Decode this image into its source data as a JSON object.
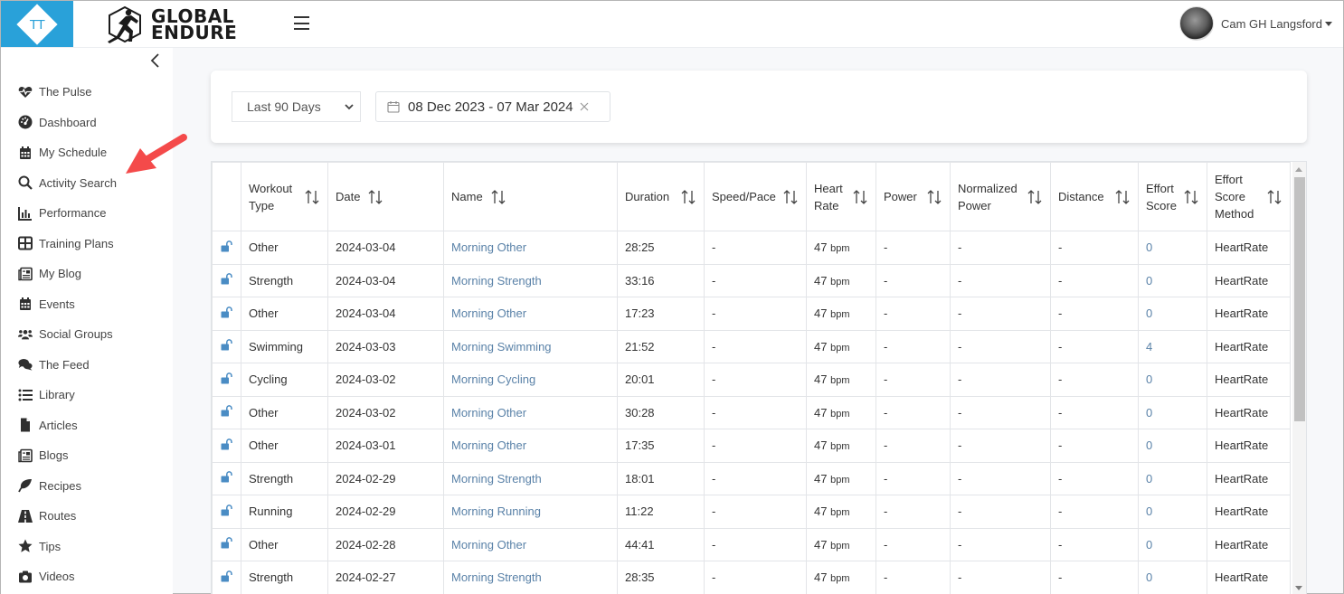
{
  "brand": {
    "tile_text": "TT",
    "logo_line1": "GLOBAL",
    "logo_line2": "ENDURE",
    "accent": "#29a1d9"
  },
  "user": {
    "name": "Cam GH Langsford"
  },
  "sidebar": {
    "items": [
      {
        "label": "The Pulse",
        "icon": "heartbeat-icon"
      },
      {
        "label": "Dashboard",
        "icon": "gauge-icon"
      },
      {
        "label": "My Schedule",
        "icon": "calendar-icon"
      },
      {
        "label": "Activity Search",
        "icon": "search-icon"
      },
      {
        "label": "Performance",
        "icon": "bar-chart-icon"
      },
      {
        "label": "Training Plans",
        "icon": "grid-icon"
      },
      {
        "label": "My Blog",
        "icon": "newspaper-icon"
      },
      {
        "label": "Events",
        "icon": "calendar-icon"
      },
      {
        "label": "Social Groups",
        "icon": "users-icon"
      },
      {
        "label": "The Feed",
        "icon": "comments-icon"
      },
      {
        "label": "Library",
        "icon": "list-icon"
      },
      {
        "label": "Articles",
        "icon": "file-icon"
      },
      {
        "label": "Blogs",
        "icon": "newspaper-icon"
      },
      {
        "label": "Recipes",
        "icon": "leaf-icon"
      },
      {
        "label": "Routes",
        "icon": "road-icon"
      },
      {
        "label": "Tips",
        "icon": "star-icon"
      },
      {
        "label": "Videos",
        "icon": "camera-icon"
      }
    ]
  },
  "filters": {
    "range_select": "Last 90 Days",
    "date_range": "08 Dec 2023 - 07 Mar 2024"
  },
  "table": {
    "columns": [
      "Workout Type",
      "Date",
      "Name",
      "Duration",
      "Speed/Pace",
      "Heart Rate",
      "Power",
      "Normalized Power",
      "Distance",
      "Effort Score",
      "Effort Score Method"
    ],
    "rows": [
      {
        "type": "Other",
        "date": "2024-03-04",
        "name": "Morning Other",
        "duration": "28:25",
        "speed": "-",
        "hr": "47",
        "hr_unit": "bpm",
        "power": "-",
        "np": "-",
        "distance": "-",
        "effort": "0",
        "method": "HeartRate"
      },
      {
        "type": "Strength",
        "date": "2024-03-04",
        "name": "Morning Strength",
        "duration": "33:16",
        "speed": "-",
        "hr": "47",
        "hr_unit": "bpm",
        "power": "-",
        "np": "-",
        "distance": "-",
        "effort": "0",
        "method": "HeartRate"
      },
      {
        "type": "Other",
        "date": "2024-03-04",
        "name": "Morning Other",
        "duration": "17:23",
        "speed": "-",
        "hr": "47",
        "hr_unit": "bpm",
        "power": "-",
        "np": "-",
        "distance": "-",
        "effort": "0",
        "method": "HeartRate"
      },
      {
        "type": "Swimming",
        "date": "2024-03-03",
        "name": "Morning Swimming",
        "duration": "21:52",
        "speed": "-",
        "hr": "47",
        "hr_unit": "bpm",
        "power": "-",
        "np": "-",
        "distance": "-",
        "effort": "4",
        "method": "HeartRate"
      },
      {
        "type": "Cycling",
        "date": "2024-03-02",
        "name": "Morning Cycling",
        "duration": "20:01",
        "speed": "-",
        "hr": "47",
        "hr_unit": "bpm",
        "power": "-",
        "np": "-",
        "distance": "-",
        "effort": "0",
        "method": "HeartRate"
      },
      {
        "type": "Other",
        "date": "2024-03-02",
        "name": "Morning Other",
        "duration": "30:28",
        "speed": "-",
        "hr": "47",
        "hr_unit": "bpm",
        "power": "-",
        "np": "-",
        "distance": "-",
        "effort": "0",
        "method": "HeartRate"
      },
      {
        "type": "Other",
        "date": "2024-03-01",
        "name": "Morning Other",
        "duration": "17:35",
        "speed": "-",
        "hr": "47",
        "hr_unit": "bpm",
        "power": "-",
        "np": "-",
        "distance": "-",
        "effort": "0",
        "method": "HeartRate"
      },
      {
        "type": "Strength",
        "date": "2024-02-29",
        "name": "Morning Strength",
        "duration": "18:01",
        "speed": "-",
        "hr": "47",
        "hr_unit": "bpm",
        "power": "-",
        "np": "-",
        "distance": "-",
        "effort": "0",
        "method": "HeartRate"
      },
      {
        "type": "Running",
        "date": "2024-02-29",
        "name": "Morning Running",
        "duration": "11:22",
        "speed": "-",
        "hr": "47",
        "hr_unit": "bpm",
        "power": "-",
        "np": "-",
        "distance": "-",
        "effort": "0",
        "method": "HeartRate"
      },
      {
        "type": "Other",
        "date": "2024-02-28",
        "name": "Morning Other",
        "duration": "44:41",
        "speed": "-",
        "hr": "47",
        "hr_unit": "bpm",
        "power": "-",
        "np": "-",
        "distance": "-",
        "effort": "0",
        "method": "HeartRate"
      },
      {
        "type": "Strength",
        "date": "2024-02-27",
        "name": "Morning Strength",
        "duration": "28:35",
        "speed": "-",
        "hr": "47",
        "hr_unit": "bpm",
        "power": "-",
        "np": "-",
        "distance": "-",
        "effort": "0",
        "method": "HeartRate"
      }
    ]
  }
}
